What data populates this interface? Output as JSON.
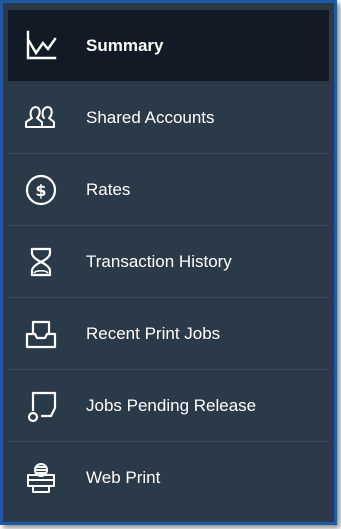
{
  "menu": {
    "items": [
      {
        "label": "Summary",
        "icon": "chart-line-icon",
        "active": true
      },
      {
        "label": "Shared Accounts",
        "icon": "users-icon",
        "active": false
      },
      {
        "label": "Rates",
        "icon": "dollar-circle-icon",
        "active": false
      },
      {
        "label": "Transaction History",
        "icon": "hourglass-icon",
        "active": false
      },
      {
        "label": "Recent Print Jobs",
        "icon": "inbox-tray-icon",
        "active": false
      },
      {
        "label": "Jobs Pending Release",
        "icon": "release-printer-icon",
        "active": false
      },
      {
        "label": "Web Print",
        "icon": "printer-icon",
        "active": false
      }
    ]
  },
  "colors": {
    "background": "#2b3a49",
    "active_background": "#121b25",
    "frame_border": "#1c5aa6",
    "text": "#ffffff"
  }
}
